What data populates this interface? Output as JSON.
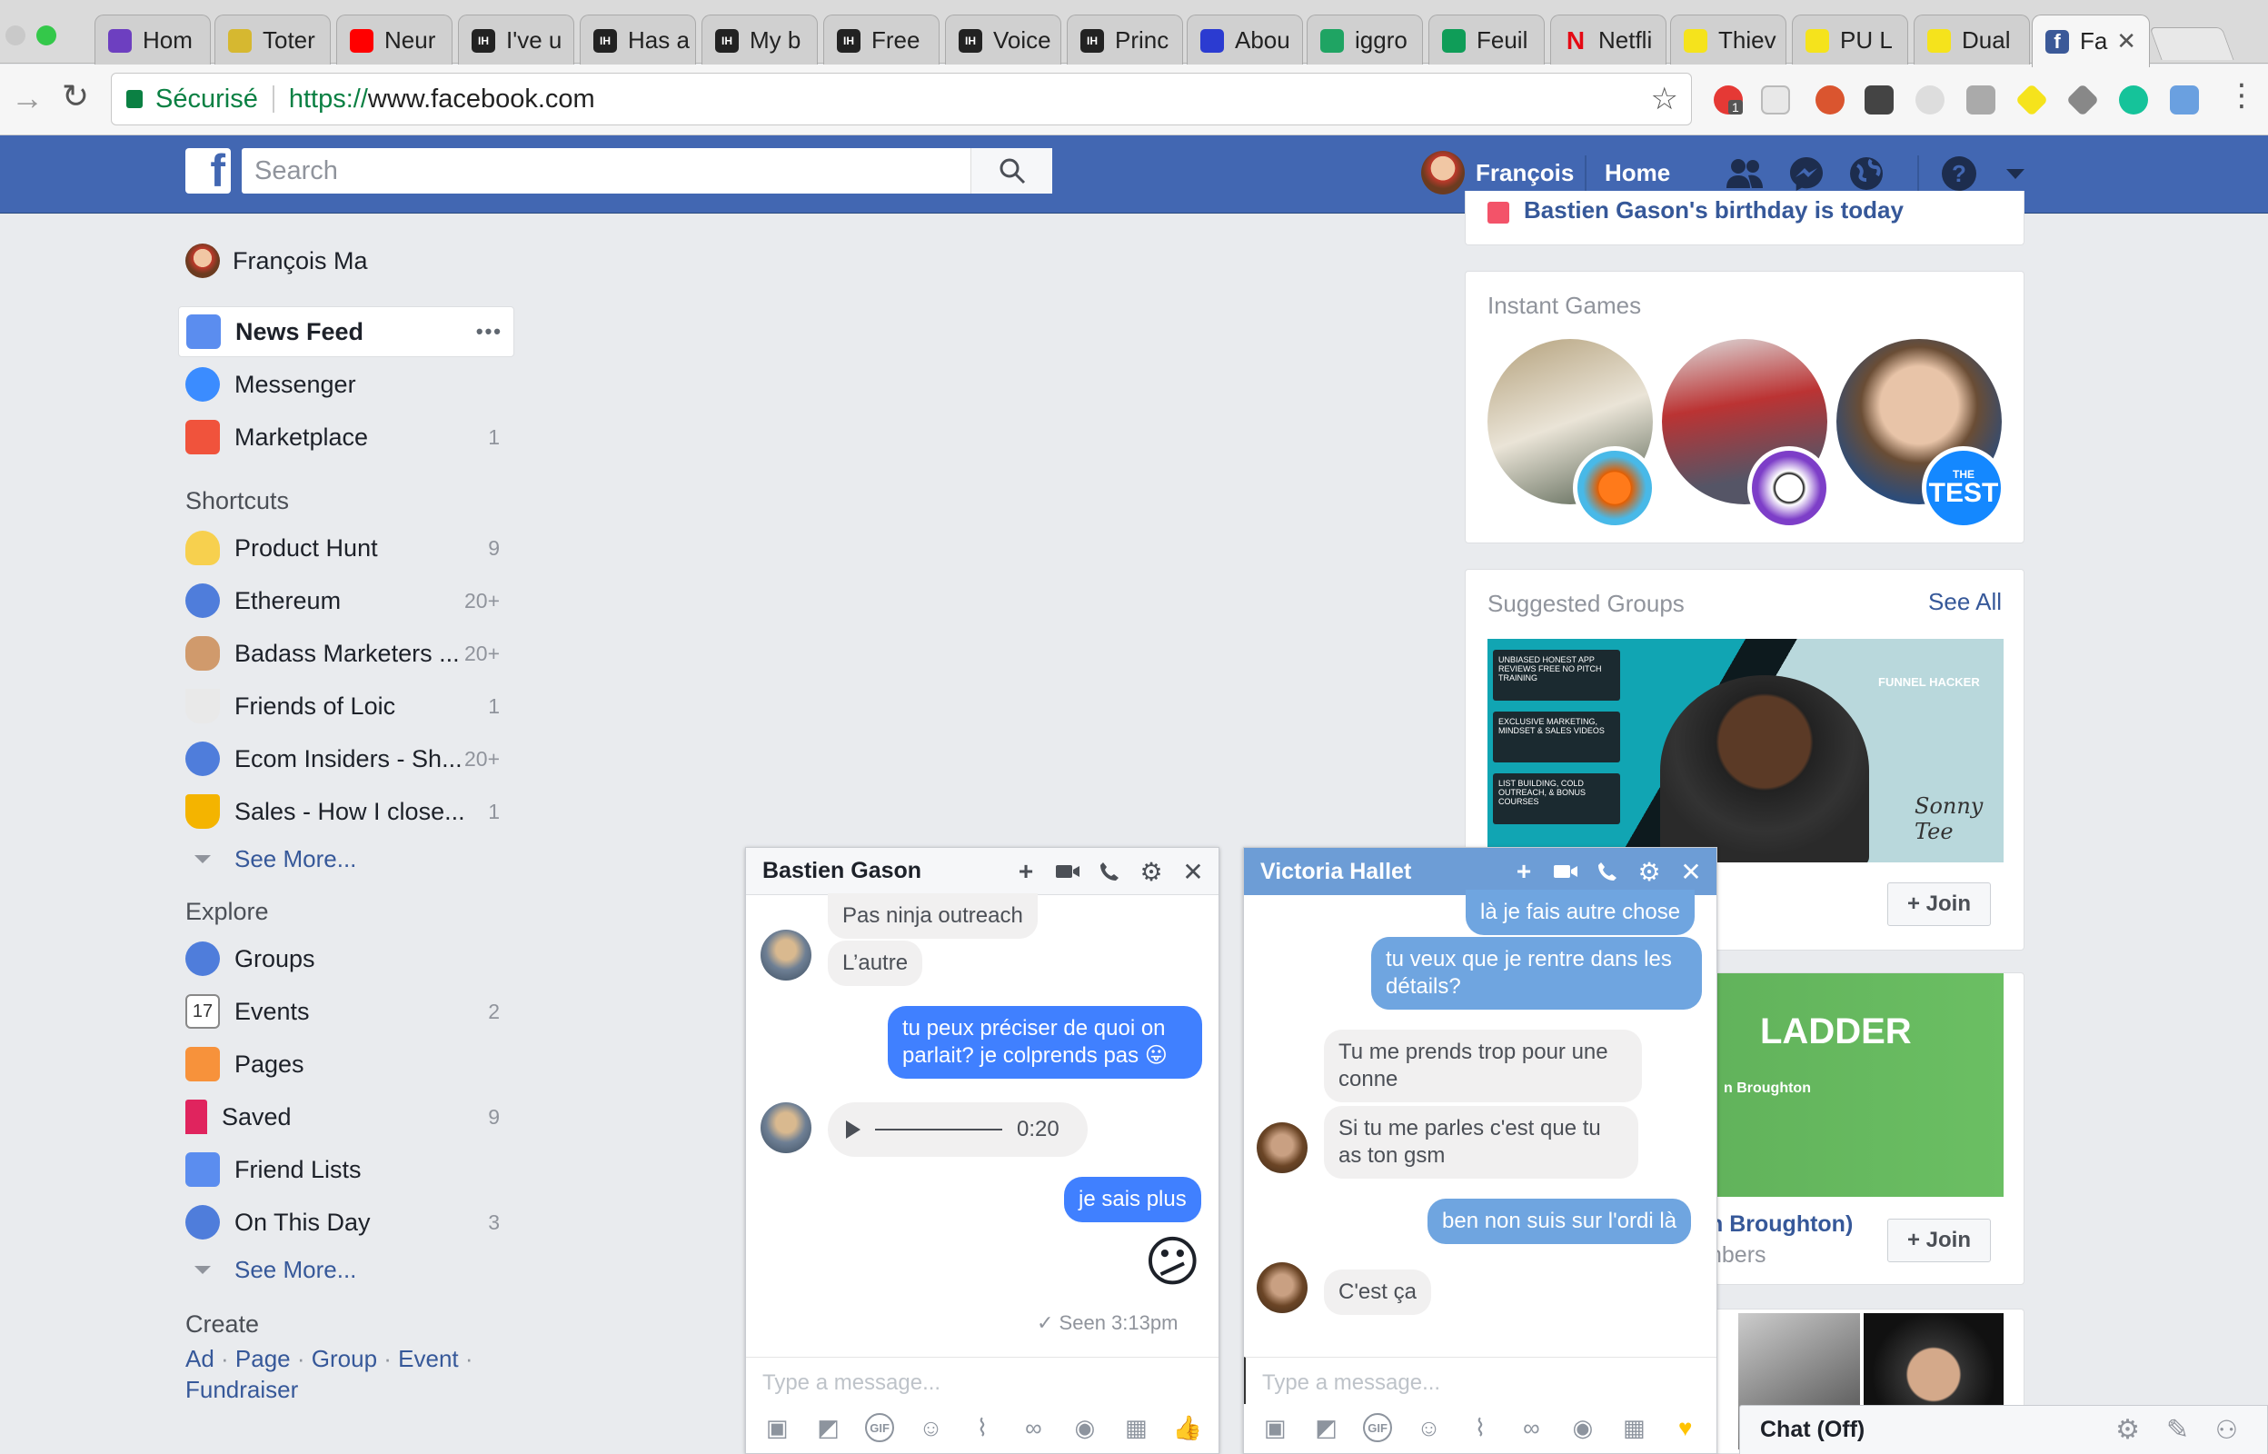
{
  "browser": {
    "tabs": [
      {
        "title": "Hom",
        "favicon": "hexagon-icon",
        "color": "#6d3fc0"
      },
      {
        "title": "Toter",
        "favicon": "totem-icon",
        "color": "#d6b830"
      },
      {
        "title": "Neur",
        "favicon": "youtube-icon",
        "color": "#ff0000"
      },
      {
        "title": "I've u",
        "favicon": "ih-icon",
        "color": "#222222"
      },
      {
        "title": "Has a",
        "favicon": "ih-icon",
        "color": "#222222"
      },
      {
        "title": "My b",
        "favicon": "ih-icon",
        "color": "#222222"
      },
      {
        "title": "Free",
        "favicon": "ih-icon",
        "color": "#222222"
      },
      {
        "title": "Voice",
        "favicon": "ih-icon",
        "color": "#222222"
      },
      {
        "title": "Princ",
        "favicon": "ih-icon",
        "color": "#222222"
      },
      {
        "title": "Abou",
        "favicon": "grid-icon",
        "color": "#2b3bd1"
      },
      {
        "title": "iggro",
        "favicon": "drive-icon",
        "color": "#1fa463"
      },
      {
        "title": "Feuil",
        "favicon": "sheets-icon",
        "color": "#0f9d58"
      },
      {
        "title": "Netfli",
        "favicon": "netflix-icon",
        "color": "#e50914"
      },
      {
        "title": "Thiev",
        "favicon": "diamond-icon",
        "color": "#f5e31c"
      },
      {
        "title": "PU L",
        "favicon": "diamond-icon",
        "color": "#f5e31c"
      },
      {
        "title": "Dual",
        "favicon": "diamond-icon",
        "color": "#f5e31c"
      },
      {
        "title": "Fa",
        "favicon": "facebook-icon",
        "color": "#3b5998"
      }
    ],
    "secure_label": "Sécurisé",
    "url_scheme": "https://",
    "url_host": "www.facebook.com",
    "ext_badge": "1"
  },
  "fb": {
    "search_placeholder": "Search",
    "user_name": "François",
    "home": "Home"
  },
  "leftnav": {
    "profile": "François Ma",
    "main": [
      {
        "label": "News Feed",
        "count": "",
        "icon": "newsfeed-icon"
      },
      {
        "label": "Messenger",
        "count": "",
        "icon": "messenger-icon"
      },
      {
        "label": "Marketplace",
        "count": "1",
        "icon": "marketplace-icon"
      }
    ],
    "shortcuts_title": "Shortcuts",
    "shortcuts": [
      {
        "label": "Product Hunt",
        "count": "9",
        "icon": "lightbulb-icon"
      },
      {
        "label": "Ethereum",
        "count": "20+",
        "icon": "group-icon"
      },
      {
        "label": "Badass Marketers ...",
        "count": "20+",
        "icon": "rock-hand-icon"
      },
      {
        "label": "Friends of Loic",
        "count": "1",
        "icon": "coffee-icon"
      },
      {
        "label": "Ecom Insiders - Sh...",
        "count": "20+",
        "icon": "group-icon"
      },
      {
        "label": "Sales - How I close...",
        "count": "1",
        "icon": "trophy-icon"
      }
    ],
    "see_more": "See More...",
    "explore_title": "Explore",
    "explore": [
      {
        "label": "Groups",
        "count": "",
        "icon": "groups-icon"
      },
      {
        "label": "Events",
        "count": "2",
        "icon": "calendar-icon",
        "day": "17"
      },
      {
        "label": "Pages",
        "count": "",
        "icon": "flag-icon"
      },
      {
        "label": "Saved",
        "count": "9",
        "icon": "bookmark-icon"
      },
      {
        "label": "Friend Lists",
        "count": "",
        "icon": "friendlist-icon"
      },
      {
        "label": "On This Day",
        "count": "3",
        "icon": "clock-icon"
      }
    ],
    "see_more_2": "See More...",
    "create_title": "Create",
    "create_links": [
      "Ad",
      "Page",
      "Group",
      "Event",
      "Fundraiser"
    ]
  },
  "right": {
    "birthday_text": "Bastien Gason's birthday is today",
    "games_title": "Instant Games",
    "test_badge_top": "THE",
    "test_badge": "TEST",
    "groups_title": "Suggested Groups",
    "see_all": "See All",
    "group1_lines": [
      "Unbiased Honest App Reviews Free No Pitch Training",
      "Exclusive Marketing, Mindset & Sales Videos",
      "List Building, Cold Outreach, & Bonus Courses"
    ],
    "group1_brand": "FUNNEL HACKER",
    "group1_sign": "Sonny Tee",
    "join": "Join",
    "group2_banner": "LADDER",
    "group2_sub": "n Broughton",
    "group2_name": "n Broughton)",
    "group2_members": "nbers"
  },
  "chat1": {
    "name": "Bastien Gason",
    "messages": [
      {
        "text": "Pas ninja outreach",
        "dir": "in"
      },
      {
        "text": "L’autre",
        "dir": "in"
      },
      {
        "text": "tu peux préciser de quoi on parlait? je colprends pas 😛",
        "dir": "out"
      },
      {
        "text": "0:20",
        "dir": "in"
      },
      {
        "text": "je sais plus",
        "dir": "out"
      },
      {
        "text": "😕",
        "dir": "out"
      }
    ],
    "seen": "Seen 3:13pm",
    "placeholder": "Type a message..."
  },
  "chat2": {
    "name": "Victoria Hallet",
    "messages": [
      {
        "text": "là je fais autre chose",
        "dir": "out"
      },
      {
        "text": "tu veux que je rentre dans les détails?",
        "dir": "out"
      },
      {
        "text": "Tu me prends trop pour une conne",
        "dir": "in"
      },
      {
        "text": "Si tu me parles c'est que tu as ton gsm",
        "dir": "in"
      },
      {
        "text": "ben non suis sur l'ordi là",
        "dir": "out"
      },
      {
        "text": "C'est ça",
        "dir": "in"
      }
    ],
    "placeholder": "Type a message..."
  },
  "chatbar": {
    "label": "Chat (Off)"
  }
}
